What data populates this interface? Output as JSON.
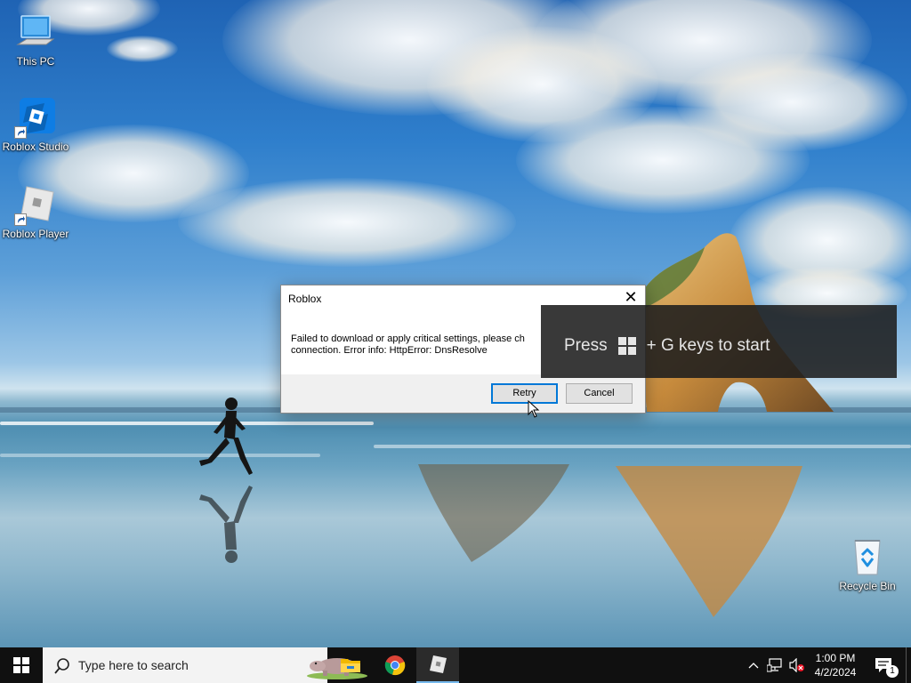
{
  "desktop": {
    "icons": [
      {
        "label": "This PC",
        "icon": "computer-icon"
      },
      {
        "label": "Roblox Studio",
        "icon": "roblox-studio-icon"
      },
      {
        "label": "Roblox Player",
        "icon": "roblox-player-icon"
      },
      {
        "label": "Recycle Bin",
        "icon": "recycle-bin-icon"
      }
    ]
  },
  "dialog": {
    "title": "Roblox",
    "message_line1": "Failed to download or apply critical settings, please ch",
    "message_line2": "connection. Error info: HttpError: DnsResolve",
    "retry_label": "Retry",
    "cancel_label": "Cancel",
    "close_glyph": "✕"
  },
  "toast": {
    "text_before": "Press",
    "text_after": "+ G keys to start"
  },
  "taskbar": {
    "search_placeholder": "Type here to search",
    "apps": [
      {
        "name": "File Explorer",
        "icon": "file-explorer-icon"
      },
      {
        "name": "Google Chrome",
        "icon": "chrome-icon"
      },
      {
        "name": "Roblox",
        "icon": "roblox-icon",
        "active": true
      }
    ],
    "clock_time": "1:00 PM",
    "clock_date": "4/2/2024",
    "notification_count": "1"
  },
  "colors": {
    "taskbar_bg": "#101010",
    "accent": "#0078d7",
    "active_app_underline": "#76b9ed"
  }
}
